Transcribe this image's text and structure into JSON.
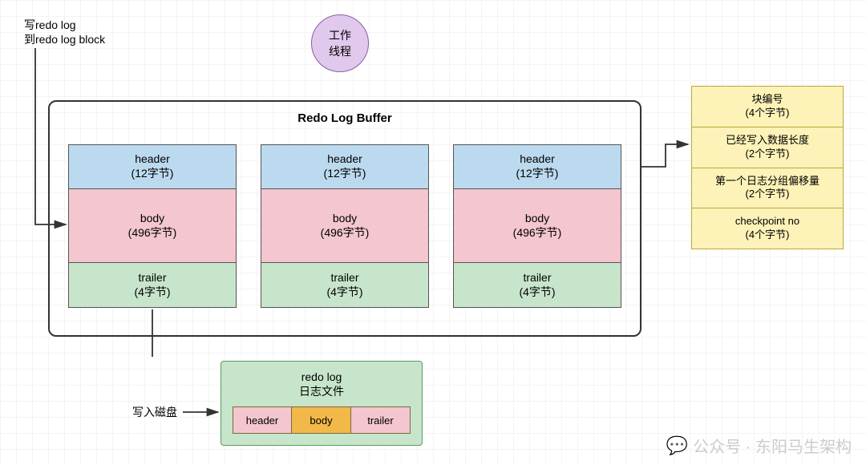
{
  "worker": {
    "line1": "工作",
    "line2": "线程"
  },
  "note_write": {
    "line1": "写redo log",
    "line2": "到redo log block"
  },
  "buffer": {
    "title": "Redo Log Buffer",
    "block": {
      "header": {
        "label": "header",
        "size": "(12字节)"
      },
      "body": {
        "label": "body",
        "size": "(496字节)"
      },
      "trailer": {
        "label": "trailer",
        "size": "(4字节)"
      }
    }
  },
  "fields": [
    {
      "title": "块编号",
      "size": "(4个字节)"
    },
    {
      "title": "已经写入数据长度",
      "size": "(2个字节)"
    },
    {
      "title": "第一个日志分组偏移量",
      "size": "(2个字节)"
    },
    {
      "title": "checkpoint no",
      "size": "(4个字节)"
    }
  ],
  "disk": {
    "label": "写入磁盘",
    "file": {
      "line1": "redo log",
      "line2": "日志文件"
    },
    "cells": {
      "header": "header",
      "body": "body",
      "trailer": "trailer"
    }
  },
  "watermark": "公众号 · 东阳马生架构"
}
